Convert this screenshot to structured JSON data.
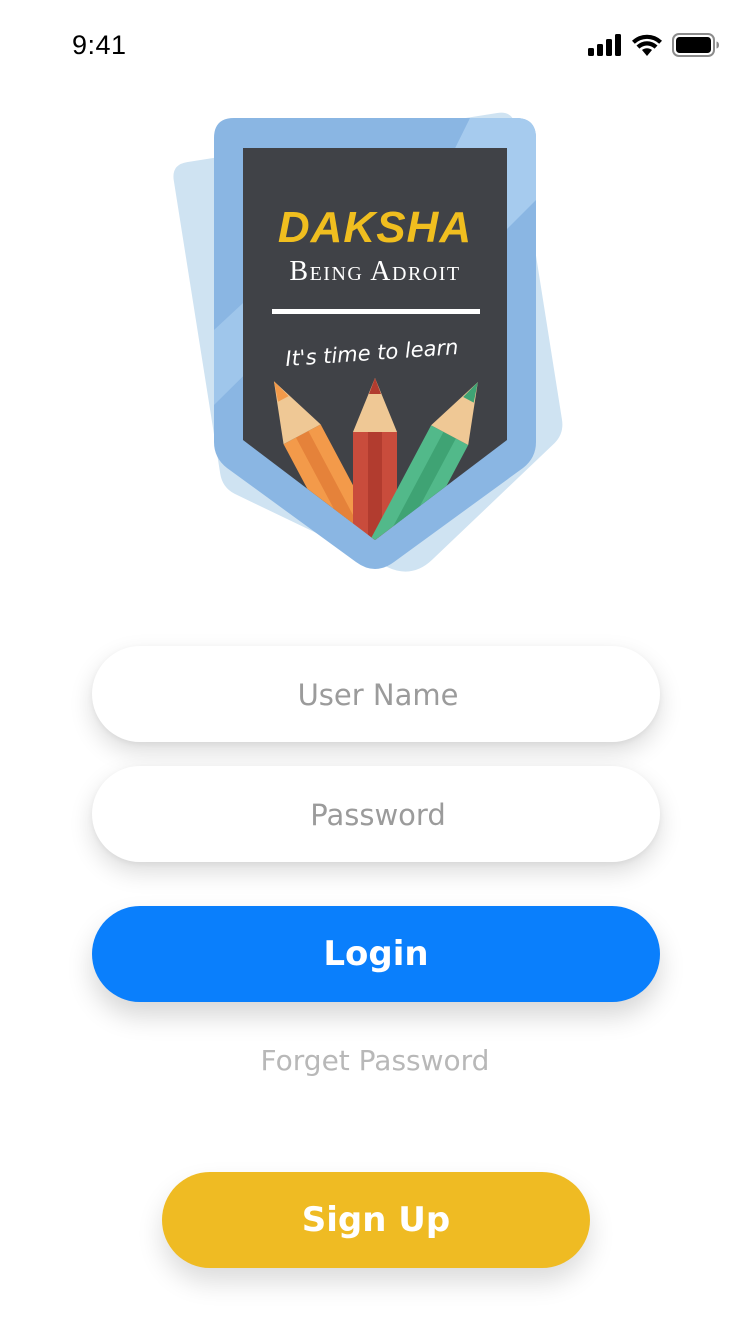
{
  "status_bar": {
    "time": "9:41",
    "icons": [
      "signal-icon",
      "wifi-icon",
      "battery-icon"
    ]
  },
  "logo": {
    "brand": "DAKSHA",
    "tagline": "Being Adroit",
    "slogan": "It's time to learn",
    "colors": {
      "badge_blue": "#8ab6e3",
      "badge_back": "#cfe3f2",
      "board": "#404247",
      "brand_yellow": "#f0be1f"
    }
  },
  "form": {
    "username": {
      "value": "",
      "placeholder": "User Name"
    },
    "password": {
      "value": "",
      "placeholder": "Password"
    }
  },
  "actions": {
    "login_label": "Login",
    "forget_label": "Forget Password",
    "signup_label": "Sign Up"
  },
  "colors": {
    "login": "#0a7ffc",
    "signup": "#efbb23",
    "placeholder": "#9b9b9b",
    "link": "#b8b8b8"
  }
}
